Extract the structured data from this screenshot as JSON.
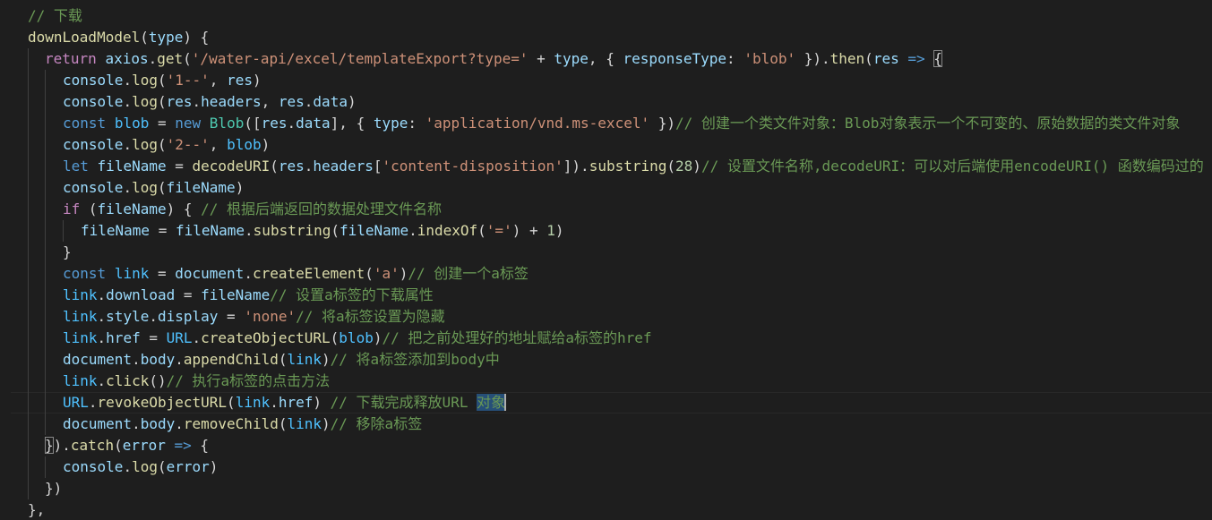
{
  "editor": {
    "colors": {
      "background": "#1e1e1e",
      "comment": "#6a9955",
      "keyword": "#569cd6",
      "control": "#c586c0",
      "function": "#dcdcaa",
      "variable": "#9cdcfe",
      "string": "#ce9178",
      "number": "#b5cea8"
    },
    "lines": [
      [
        [
          "cm",
          "// 下载"
        ]
      ],
      [
        [
          "fn",
          "downLoadModel"
        ],
        [
          "pun",
          "("
        ],
        [
          "var",
          "type"
        ],
        [
          "pun",
          ") {"
        ]
      ],
      [
        [
          "ctl",
          "return"
        ],
        [
          "pun",
          " "
        ],
        [
          "var",
          "axios"
        ],
        [
          "pun",
          "."
        ],
        [
          "fn",
          "get"
        ],
        [
          "pun",
          "("
        ],
        [
          "str",
          "'/water-api/excel/templateExport?type='"
        ],
        [
          "pun",
          " + "
        ],
        [
          "var",
          "type"
        ],
        [
          "pun",
          ", { "
        ],
        [
          "prop",
          "responseType"
        ],
        [
          "pun",
          ": "
        ],
        [
          "str",
          "'blob'"
        ],
        [
          "pun",
          " })."
        ],
        [
          "fn",
          "then"
        ],
        [
          "pun",
          "("
        ],
        [
          "var",
          "res"
        ],
        [
          "pun",
          " "
        ],
        [
          "kw",
          "=>"
        ],
        [
          "pun",
          " "
        ],
        [
          "bracket",
          "{"
        ]
      ],
      [
        [
          "var",
          "console"
        ],
        [
          "pun",
          "."
        ],
        [
          "fn",
          "log"
        ],
        [
          "pun",
          "("
        ],
        [
          "str",
          "'1--'"
        ],
        [
          "pun",
          ", "
        ],
        [
          "var",
          "res"
        ],
        [
          "pun",
          ")"
        ]
      ],
      [
        [
          "var",
          "console"
        ],
        [
          "pun",
          "."
        ],
        [
          "fn",
          "log"
        ],
        [
          "pun",
          "("
        ],
        [
          "var",
          "res"
        ],
        [
          "pun",
          "."
        ],
        [
          "prop",
          "headers"
        ],
        [
          "pun",
          ", "
        ],
        [
          "var",
          "res"
        ],
        [
          "pun",
          "."
        ],
        [
          "prop",
          "data"
        ],
        [
          "pun",
          ")"
        ]
      ],
      [
        [
          "kw",
          "const"
        ],
        [
          "pun",
          " "
        ],
        [
          "const",
          "blob"
        ],
        [
          "pun",
          " = "
        ],
        [
          "kw",
          "new"
        ],
        [
          "pun",
          " "
        ],
        [
          "cls",
          "Blob"
        ],
        [
          "pun",
          "(["
        ],
        [
          "var",
          "res"
        ],
        [
          "pun",
          "."
        ],
        [
          "prop",
          "data"
        ],
        [
          "pun",
          "], { "
        ],
        [
          "prop",
          "type"
        ],
        [
          "pun",
          ": "
        ],
        [
          "str",
          "'application/vnd.ms-excel'"
        ],
        [
          "pun",
          " })"
        ],
        [
          "cm",
          "// 创建一个类文件对象：Blob对象表示一个不可变的、原始数据的类文件对象"
        ]
      ],
      [
        [
          "var",
          "console"
        ],
        [
          "pun",
          "."
        ],
        [
          "fn",
          "log"
        ],
        [
          "pun",
          "("
        ],
        [
          "str",
          "'2--'"
        ],
        [
          "pun",
          ", "
        ],
        [
          "const",
          "blob"
        ],
        [
          "pun",
          ")"
        ]
      ],
      [
        [
          "kw",
          "let"
        ],
        [
          "pun",
          " "
        ],
        [
          "var",
          "fileName"
        ],
        [
          "pun",
          " = "
        ],
        [
          "fn",
          "decodeURI"
        ],
        [
          "pun",
          "("
        ],
        [
          "var",
          "res"
        ],
        [
          "pun",
          "."
        ],
        [
          "prop",
          "headers"
        ],
        [
          "pun",
          "["
        ],
        [
          "str",
          "'content-disposition'"
        ],
        [
          "pun",
          "])."
        ],
        [
          "fn",
          "substring"
        ],
        [
          "pun",
          "("
        ],
        [
          "num",
          "28"
        ],
        [
          "pun",
          ")"
        ],
        [
          "cm",
          "// 设置文件名称,decodeURI：可以对后端使用encodeURI() 函数编码过的 URI 进行解码"
        ]
      ],
      [
        [
          "var",
          "console"
        ],
        [
          "pun",
          "."
        ],
        [
          "fn",
          "log"
        ],
        [
          "pun",
          "("
        ],
        [
          "var",
          "fileName"
        ],
        [
          "pun",
          ")"
        ]
      ],
      [
        [
          "ctl",
          "if"
        ],
        [
          "pun",
          " ("
        ],
        [
          "var",
          "fileName"
        ],
        [
          "pun",
          ") { "
        ],
        [
          "cm",
          "// 根据后端返回的数据处理文件名称"
        ]
      ],
      [
        [
          "var",
          "fileName"
        ],
        [
          "pun",
          " = "
        ],
        [
          "var",
          "fileName"
        ],
        [
          "pun",
          "."
        ],
        [
          "fn",
          "substring"
        ],
        [
          "pun",
          "("
        ],
        [
          "var",
          "fileName"
        ],
        [
          "pun",
          "."
        ],
        [
          "fn",
          "indexOf"
        ],
        [
          "pun",
          "("
        ],
        [
          "str",
          "'='"
        ],
        [
          "pun",
          ") + "
        ],
        [
          "num",
          "1"
        ],
        [
          "pun",
          ")"
        ]
      ],
      [
        [
          "pun",
          "}"
        ]
      ],
      [
        [
          "kw",
          "const"
        ],
        [
          "pun",
          " "
        ],
        [
          "const",
          "link"
        ],
        [
          "pun",
          " = "
        ],
        [
          "var",
          "document"
        ],
        [
          "pun",
          "."
        ],
        [
          "fn",
          "createElement"
        ],
        [
          "pun",
          "("
        ],
        [
          "str",
          "'a'"
        ],
        [
          "pun",
          ")"
        ],
        [
          "cm",
          "// 创建一个a标签"
        ]
      ],
      [
        [
          "const",
          "link"
        ],
        [
          "pun",
          "."
        ],
        [
          "prop",
          "download"
        ],
        [
          "pun",
          " = "
        ],
        [
          "var",
          "fileName"
        ],
        [
          "cm",
          "// 设置a标签的下载属性"
        ]
      ],
      [
        [
          "const",
          "link"
        ],
        [
          "pun",
          "."
        ],
        [
          "prop",
          "style"
        ],
        [
          "pun",
          "."
        ],
        [
          "prop",
          "display"
        ],
        [
          "pun",
          " = "
        ],
        [
          "str",
          "'none'"
        ],
        [
          "cm",
          "// 将a标签设置为隐藏"
        ]
      ],
      [
        [
          "const",
          "link"
        ],
        [
          "pun",
          "."
        ],
        [
          "prop",
          "href"
        ],
        [
          "pun",
          " = "
        ],
        [
          "const",
          "URL"
        ],
        [
          "pun",
          "."
        ],
        [
          "fn",
          "createObjectURL"
        ],
        [
          "pun",
          "("
        ],
        [
          "const",
          "blob"
        ],
        [
          "pun",
          ")"
        ],
        [
          "cm",
          "// 把之前处理好的地址赋给a标签的href"
        ]
      ],
      [
        [
          "var",
          "document"
        ],
        [
          "pun",
          "."
        ],
        [
          "prop",
          "body"
        ],
        [
          "pun",
          "."
        ],
        [
          "fn",
          "appendChild"
        ],
        [
          "pun",
          "("
        ],
        [
          "const",
          "link"
        ],
        [
          "pun",
          ")"
        ],
        [
          "cm",
          "// 将a标签添加到body中"
        ]
      ],
      [
        [
          "const",
          "link"
        ],
        [
          "pun",
          "."
        ],
        [
          "fn",
          "click"
        ],
        [
          "pun",
          "()"
        ],
        [
          "cm",
          "// 执行a标签的点击方法"
        ]
      ],
      [
        [
          "const",
          "URL"
        ],
        [
          "pun",
          "."
        ],
        [
          "fn",
          "revokeObjectURL"
        ],
        [
          "pun",
          "("
        ],
        [
          "const",
          "link"
        ],
        [
          "pun",
          "."
        ],
        [
          "prop",
          "href"
        ],
        [
          "pun",
          ") "
        ],
        [
          "cm",
          "// 下载完成释放URL "
        ],
        [
          "sel",
          "对象"
        ],
        [
          "caret",
          ""
        ]
      ],
      [
        [
          "var",
          "document"
        ],
        [
          "pun",
          "."
        ],
        [
          "prop",
          "body"
        ],
        [
          "pun",
          "."
        ],
        [
          "fn",
          "removeChild"
        ],
        [
          "pun",
          "("
        ],
        [
          "const",
          "link"
        ],
        [
          "pun",
          ")"
        ],
        [
          "cm",
          "// 移除a标签"
        ]
      ],
      [
        [
          "bracket",
          "}"
        ],
        [
          "pun",
          ")."
        ],
        [
          "fn",
          "catch"
        ],
        [
          "pun",
          "("
        ],
        [
          "var",
          "error"
        ],
        [
          "pun",
          " "
        ],
        [
          "kw",
          "=>"
        ],
        [
          "pun",
          " {"
        ]
      ],
      [
        [
          "var",
          "console"
        ],
        [
          "pun",
          "."
        ],
        [
          "fn",
          "log"
        ],
        [
          "pun",
          "("
        ],
        [
          "var",
          "error"
        ],
        [
          "pun",
          ")"
        ]
      ],
      [
        [
          "pun",
          "})"
        ]
      ],
      [
        [
          "pun",
          "},"
        ]
      ]
    ]
  }
}
